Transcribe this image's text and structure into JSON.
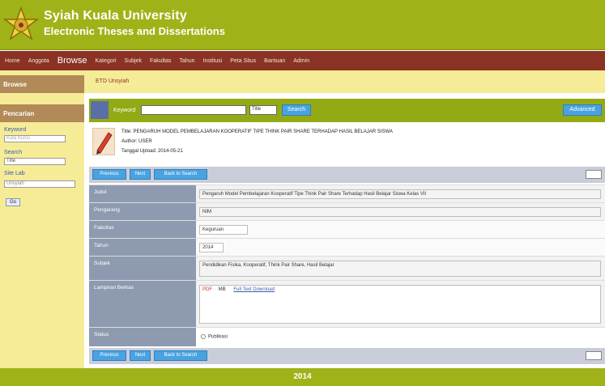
{
  "header": {
    "title": "Syiah Kuala University",
    "subtitle": "Electronic Theses and Dissertations"
  },
  "nav": {
    "items": [
      "Home",
      "Anggota",
      "Browse",
      "Kategori",
      "Subjek",
      "Fakultas",
      "Tahun",
      "Institusi",
      "Peta Situs",
      "Bantuan",
      "Admin"
    ]
  },
  "sidebar": {
    "heading1": "Browse",
    "heading2": "Pencarian",
    "label_keyword": "Keyword",
    "input_keyword_value": "",
    "input_keyword_placeholder": "Kata Kunci",
    "label_search": "Search",
    "input_search_value": "Title",
    "label_site": "Site Lab",
    "select_site_value": "Unsyiah",
    "go_button": "Go"
  },
  "breadcrumb": {
    "text": "ETD Unsyiah"
  },
  "searchbar": {
    "label": "Keyword",
    "input_value": "",
    "select_value": "Title",
    "search_button": "Search",
    "right_button": "Advanced"
  },
  "record": {
    "line1": "Title: PENGARUH MODEL PEMBELAJARAN KOOPERATIF TIPE THINK PAIR SHARE TERHADAP HASIL BELAJAR SISWA",
    "line2": "Author: USER",
    "line3": "Tanggal Upload: 2014-05-21"
  },
  "buttons_top": [
    "Previous",
    "Next",
    "Back to Search"
  ],
  "buttons_bottom": [
    "Previous",
    "Next",
    "Back to Search"
  ],
  "form": {
    "rows": [
      {
        "label": "Judul",
        "value": "Pengaruh Model Pembelajaran Kooperatif Tipe Think Pair Share Terhadap Hasil Belajar Siswa Kelas VII"
      },
      {
        "label": "Pengarang",
        "value": "NIM"
      },
      {
        "label": "Fakultas",
        "value": "Keguruan"
      },
      {
        "label": "Tahun",
        "value": "2014"
      },
      {
        "label": "Subjek",
        "value": "Pendidikan Fisika, Kooperatif, Think Pair Share, Hasil Belajar"
      },
      {
        "label": "Lampiran Berkas",
        "file_type": "PDF",
        "file_size": "MB",
        "file_name": "Full Text Download"
      },
      {
        "label": "Status",
        "value": "Publikasi"
      }
    ]
  },
  "footer": {
    "text": "2014"
  },
  "colors": {
    "header_green": "#9fb318",
    "nav_maroon": "#8a3325",
    "sidebar_yellow": "#f6eb97",
    "button_blue": "#4aa3e0"
  }
}
